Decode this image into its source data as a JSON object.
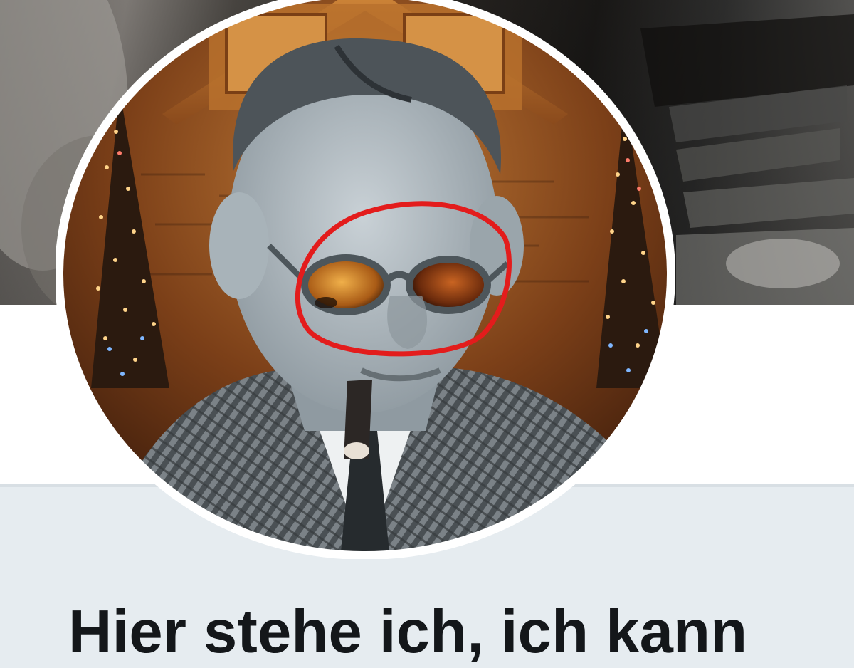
{
  "profile": {
    "display_name": "Hier stehe ich, ich kann"
  },
  "icons": {
    "avatar": "profile-avatar-image",
    "highlight": "red-circle-annotation"
  },
  "colors": {
    "page_background": "#e6ecf0",
    "profile_strip": "#ffffff",
    "text": "#14171a",
    "annotation": "#e31c1c",
    "avatar_border": "#ffffff"
  }
}
